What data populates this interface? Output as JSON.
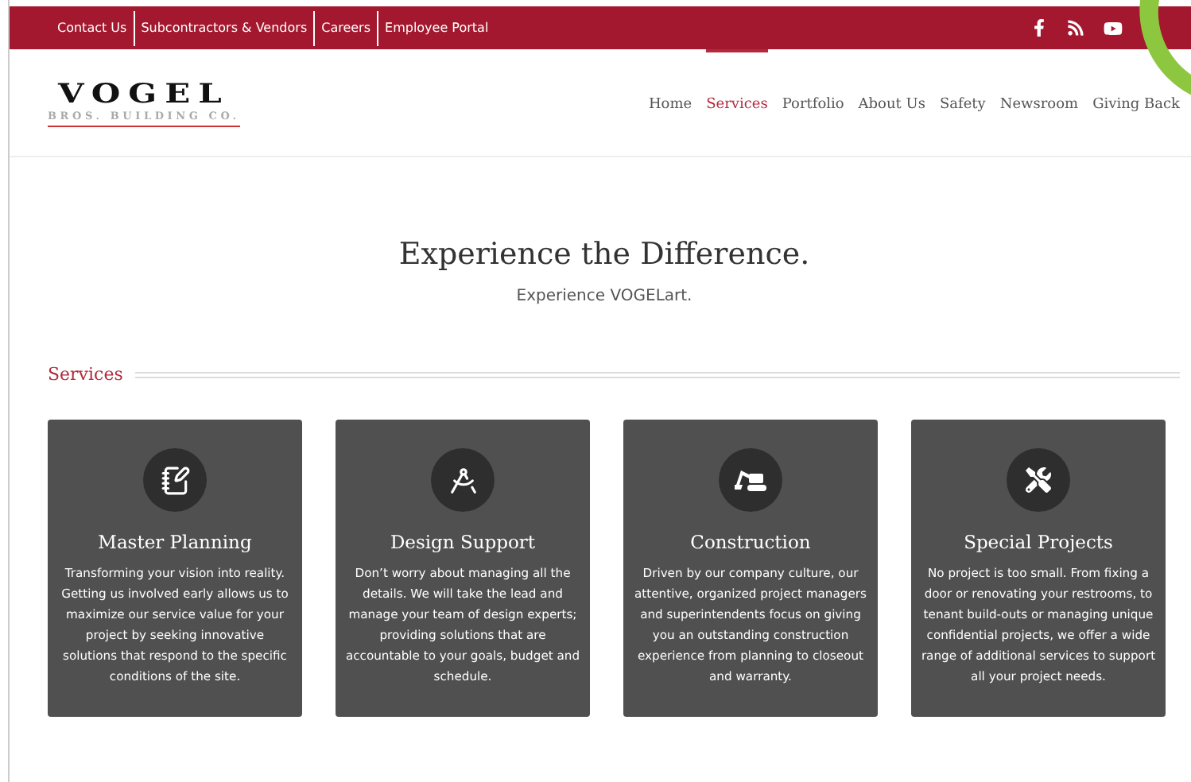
{
  "top_bar": {
    "links": [
      "Contact Us",
      "Subcontractors & Vendors",
      "Careers",
      "Employee Portal"
    ]
  },
  "logo": {
    "name": "VOGEL",
    "tagline": "BROS. BUILDING CO."
  },
  "nav": [
    {
      "label": "Home",
      "selected": false
    },
    {
      "label": "Services",
      "selected": true
    },
    {
      "label": "Portfolio",
      "selected": false
    },
    {
      "label": "About Us",
      "selected": false
    },
    {
      "label": "Safety",
      "selected": false
    },
    {
      "label": "Newsroom",
      "selected": false
    },
    {
      "label": "Giving Back",
      "selected": false
    }
  ],
  "hero": {
    "title": "Experience the Difference.",
    "subtitle": "Experience VOGELart."
  },
  "section_title": "Services",
  "cards": [
    {
      "title": "Master Planning",
      "text": "Transforming your vision into reality. Getting us involved early allows us to maximize our service value for your project by seeking innovative solutions that respond to the specific conditions of the site."
    },
    {
      "title": "Design Support",
      "text": "Don’t worry about managing all the details. We will take the lead and manage your team of design experts; providing solutions that are accountable to your goals, budget and schedule."
    },
    {
      "title": "Construction",
      "text": "Driven by our company culture, our attentive, organized project managers and superintendents focus on giving you an outstanding construction experience from planning to closeout and warranty."
    },
    {
      "title": "Special Projects",
      "text": "No project is too small. From fixing a door or renovating your restrooms, to tenant build-outs or managing unique confidential projects, we offer a wide range of additional services to support all your project needs."
    }
  ]
}
